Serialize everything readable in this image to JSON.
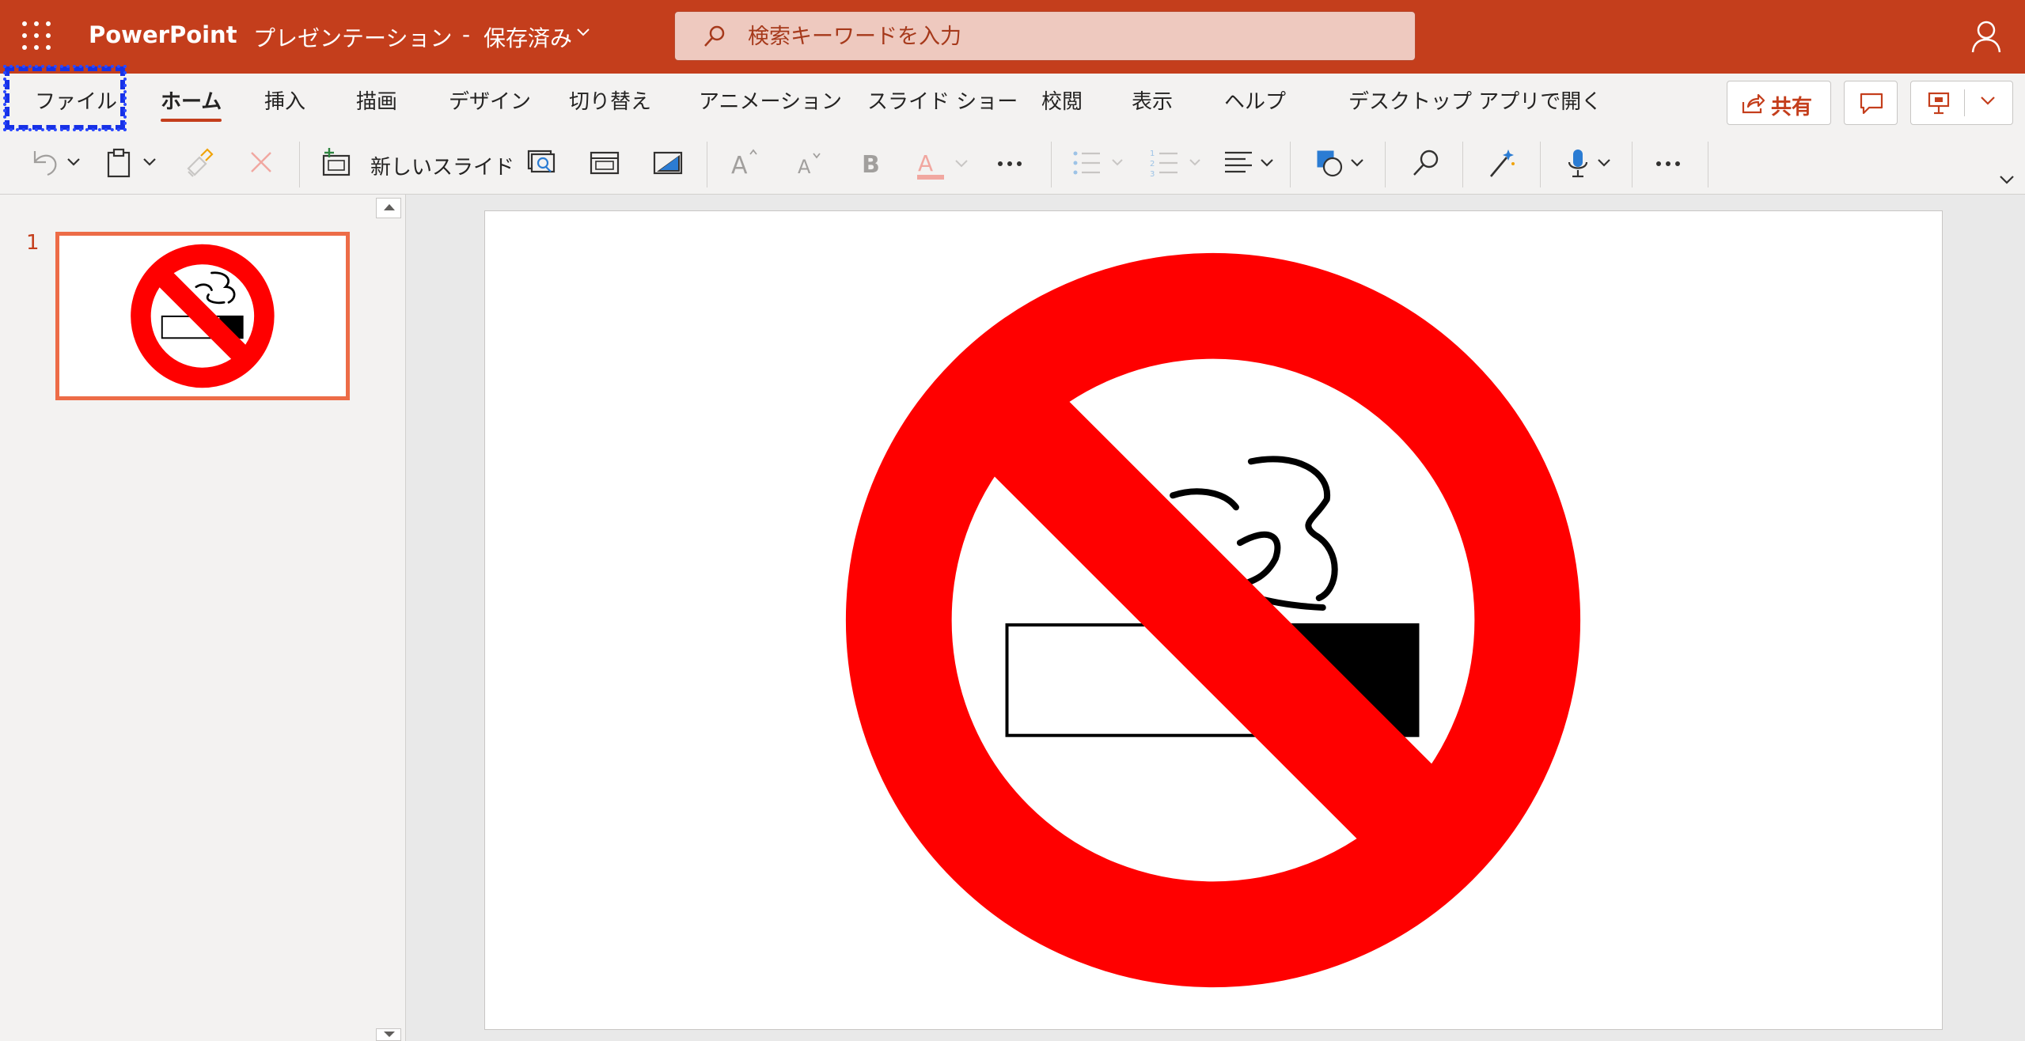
{
  "app": {
    "name": "PowerPoint"
  },
  "document": {
    "title": "プレゼンテーション",
    "separator": "-",
    "status": "保存済み"
  },
  "search": {
    "placeholder": "検索キーワードを入力"
  },
  "tabs": [
    {
      "id": "file",
      "label": "ファイル"
    },
    {
      "id": "home",
      "label": "ホーム"
    },
    {
      "id": "insert",
      "label": "挿入"
    },
    {
      "id": "draw",
      "label": "描画"
    },
    {
      "id": "design",
      "label": "デザイン"
    },
    {
      "id": "transitions",
      "label": "切り替え"
    },
    {
      "id": "animations",
      "label": "アニメーション"
    },
    {
      "id": "slideshow",
      "label": "スライド ショー"
    },
    {
      "id": "review",
      "label": "校閲"
    },
    {
      "id": "view",
      "label": "表示"
    },
    {
      "id": "help",
      "label": "ヘルプ"
    },
    {
      "id": "open_desktop",
      "label": "デスクトップ アプリで開く"
    }
  ],
  "active_tab": "home",
  "header_actions": {
    "share_label": "共有"
  },
  "toolbar": {
    "new_slide_label": "新しいスライド"
  },
  "slides": [
    {
      "number": "1"
    }
  ],
  "colors": {
    "brand": "#c43e1c",
    "thumb_border": "#ed6c47",
    "prohibit_red": "#ff0000",
    "highlight": "#1731e6"
  },
  "icons": [
    "app-launcher-icon",
    "search-icon",
    "user-icon",
    "share-icon",
    "comment-icon",
    "present-icon",
    "chevron-down-icon",
    "undo-icon",
    "paste-icon",
    "format-painter-icon",
    "clear-icon",
    "new-slide-icon",
    "reuse-slides-icon",
    "layout-icon",
    "background-icon",
    "increase-font-icon",
    "decrease-font-icon",
    "bold-icon",
    "font-color-icon",
    "more-icon",
    "bullets-icon",
    "numbering-icon",
    "align-icon",
    "shapes-icon",
    "find-icon",
    "designer-icon",
    "dictate-icon"
  ]
}
